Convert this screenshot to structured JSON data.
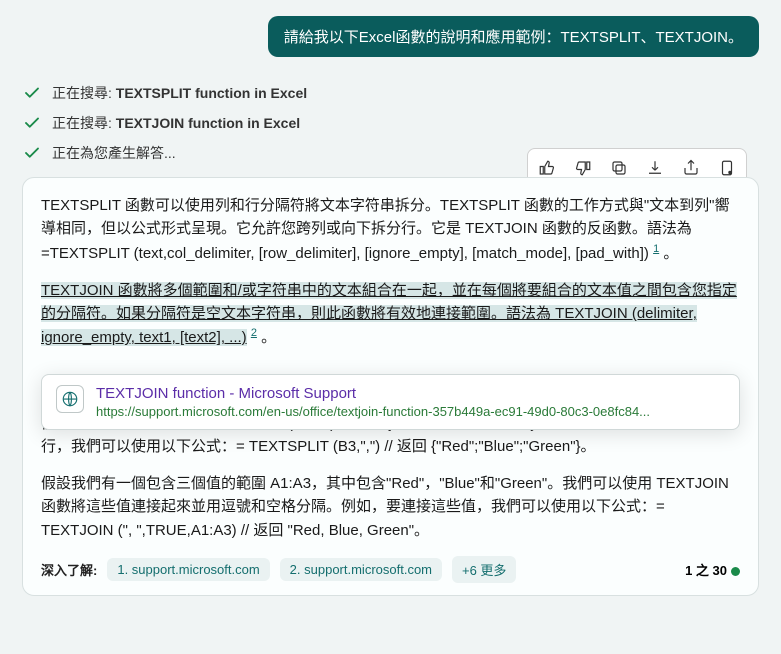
{
  "user_message": "請給我以下Excel函數的說明和應用範例：TEXTSPLIT、TEXTJOIN。",
  "status": {
    "search1_prefix": "正在搜尋: ",
    "search1_query": "TEXTSPLIT function in Excel",
    "search2_prefix": "正在搜尋: ",
    "search2_query": "TEXTJOIN function in Excel",
    "generating": "正在為您產生解答..."
  },
  "answer": {
    "p1": "TEXTSPLIT 函數可以使用列和行分隔符將文本字符串拆分。TEXTSPLIT 函數的工作方式與\"文本到列\"嚮導相同，但以公式形式呈現。它允許您跨列或向下拆分行。它是 TEXTJOIN 函數的反函數。語法為 =TEXTSPLIT (text,col_delimiter, [row_delimiter], [ignore_empty], [match_mode], [pad_with])",
    "sup1": "1",
    "p1_tail": "。",
    "p2_link": "TEXTJOIN 函數將多個範圍和/或字符串中的文本組合在一起，並在每個將要組合的文本值之間包含您指定的分隔符。如果分隔符是空文本字符串，則此函數將有效地連接範圍。語法為 TEXTJOIN (delimiter, ignore_empty, text1, [text2], ...)",
    "sup2": "2",
    "p2_tail": "。",
    "p3": "們可以使用以下公式：= TEXTSPLIT (B3,\",\") // 返回 {\"Red\",\"Blue\",\"Green\"}。要將這些值拆分為單獨的行，我們可以使用以下公式：= TEXTSPLIT (B3,\",\") // 返回 {\"Red\";\"Blue\";\"Green\"}。",
    "p4": "假設我們有一個包含三個值的範圍 A1:A3，其中包含\"Red\"，\"Blue\"和\"Green\"。我們可以使用 TEXTJOIN 函數將這些值連接起來並用逗號和空格分隔。例如，要連接這些值，我們可以使用以下公式：= TEXTJOIN (\", \",TRUE,A1:A3) // 返回 \"Red, Blue, Green\"。"
  },
  "tooltip": {
    "title": "TEXTJOIN function - Microsoft Support",
    "url": "https://support.microsoft.com/en-us/office/textjoin-function-357b449a-ec91-49d0-80c3-0e8fc84..."
  },
  "footer": {
    "learn": "深入了解:",
    "src1": "1. support.microsoft.com",
    "src2": "2. support.microsoft.com",
    "more": "+6 更多",
    "pager": "1 之 30"
  }
}
